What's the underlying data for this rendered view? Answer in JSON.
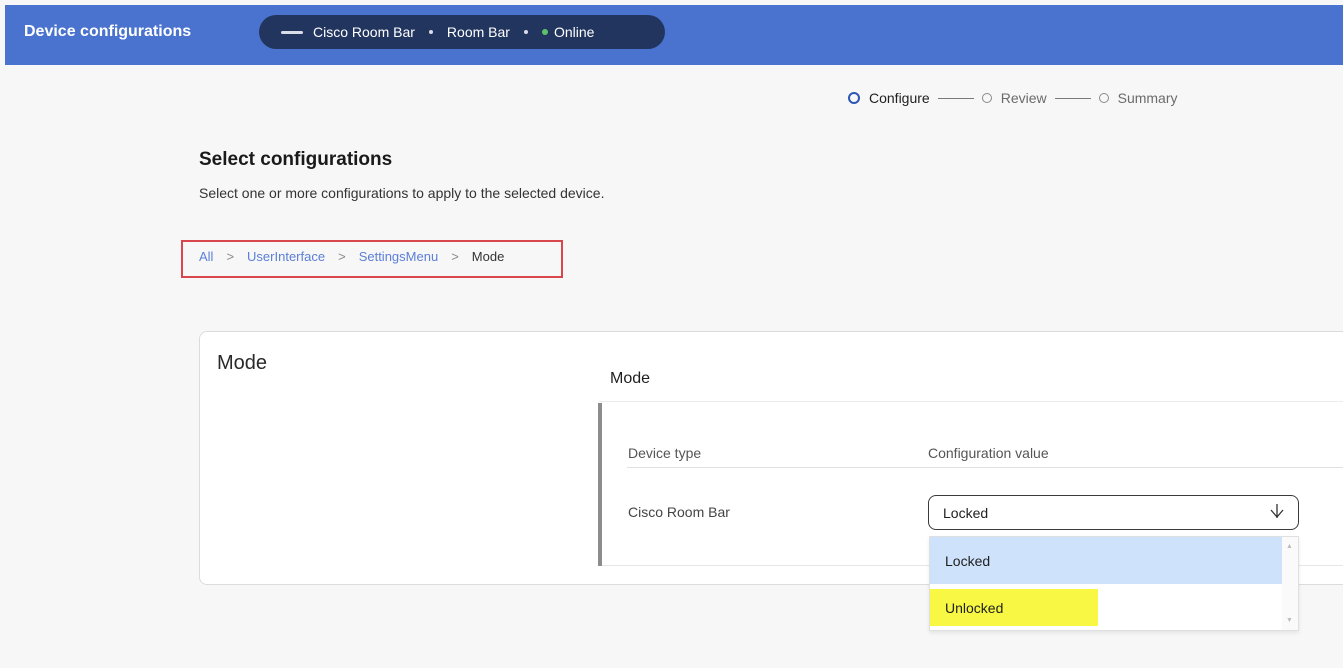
{
  "header": {
    "title": "Device configurations",
    "device": {
      "model": "Cisco Room Bar",
      "name": "Room Bar",
      "status": "Online",
      "status_color": "#5cc36a"
    },
    "bar_color": "#4a73cf"
  },
  "stepper": {
    "steps": [
      "Configure",
      "Review",
      "Summary"
    ],
    "active": "Configure"
  },
  "page": {
    "title": "Select configurations",
    "subtitle": "Select one or more configurations to apply to the selected device."
  },
  "breadcrumb": {
    "items": [
      "All",
      "UserInterface",
      "SettingsMenu",
      "Mode"
    ],
    "separator": ">"
  },
  "card": {
    "title": "Mode",
    "section_title": "Mode",
    "columns": [
      "Device type",
      "Configuration value"
    ],
    "rows": [
      {
        "device_type": "Cisco Room Bar",
        "value": "Locked"
      }
    ]
  },
  "dropdown": {
    "selected": "Locked",
    "arrow_icon": "arrow-down-icon",
    "options": [
      "Locked",
      "Unlocked"
    ],
    "highlighted_option": "Unlocked",
    "highlight_color": "#f7f744"
  }
}
